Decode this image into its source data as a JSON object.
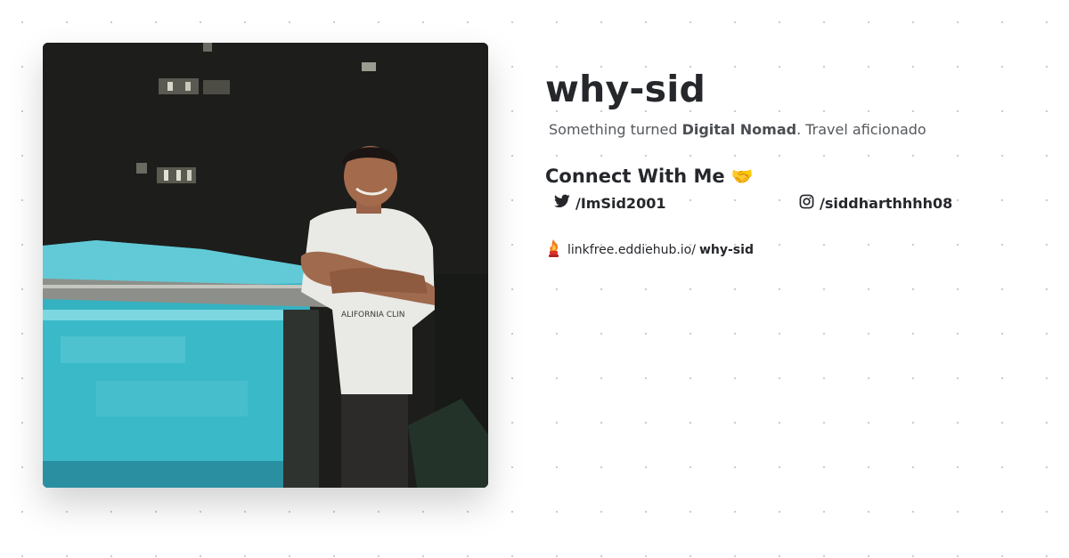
{
  "profile": {
    "name": "why-sid",
    "bio_prefix": "Something turned ",
    "bio_highlight": "Digital Nomad",
    "bio_suffix": ". Travel aficionado",
    "connect_heading": "Connect With Me",
    "connect_emoji": "🤝"
  },
  "socials": [
    {
      "platform": "twitter",
      "icon": "twitter-icon",
      "handle": "/ImSid2001"
    },
    {
      "platform": "instagram",
      "icon": "instagram-icon",
      "handle": "/siddharthhhh08"
    }
  ],
  "footer": {
    "icon": "linkfree-logo-icon",
    "domain": "linkfree.eddiehub.io/",
    "username": "why-sid"
  },
  "colors": {
    "text": "#25272b",
    "muted": "#55585d",
    "background": "#ffffff",
    "dot_grid": "#c6c9ce"
  }
}
